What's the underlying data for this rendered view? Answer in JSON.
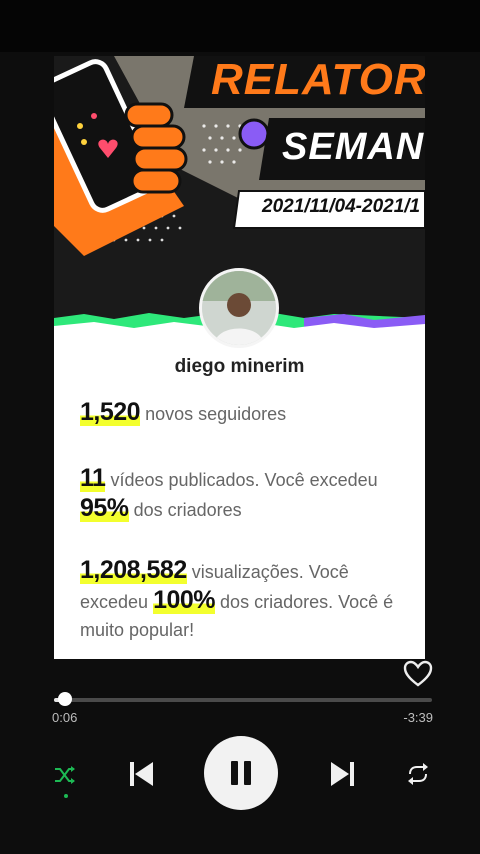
{
  "card": {
    "title_line1": "RELATOR",
    "title_line2": "SEMAN",
    "date_range": "2021/11/04-2021/1",
    "username": "diego minerim",
    "stats": {
      "followers_value": "1,520",
      "followers_label": "novos seguidores",
      "videos_value": "11",
      "videos_label": "vídeos publicados.  Você excedeu",
      "videos_pct": "95%",
      "videos_pct_label": "dos criadores",
      "views_value": "1,208,582",
      "views_label": "visualizações.  Você",
      "views_label2": "excedeu",
      "views_pct": "100%",
      "views_pct_label": "dos criadores.  Você é",
      "views_tail": "muito popular!"
    }
  },
  "player": {
    "elapsed": "0:06",
    "remaining": "-3:39",
    "progress": 0.03,
    "shuffle_active": true
  },
  "colors": {
    "accent_orange": "#ff7a1a",
    "highlight_yellow": "#f3ff2e",
    "shuffle_green": "#1db954",
    "banner_purple": "#8a5cf5",
    "banner_green": "#2ee87a"
  }
}
